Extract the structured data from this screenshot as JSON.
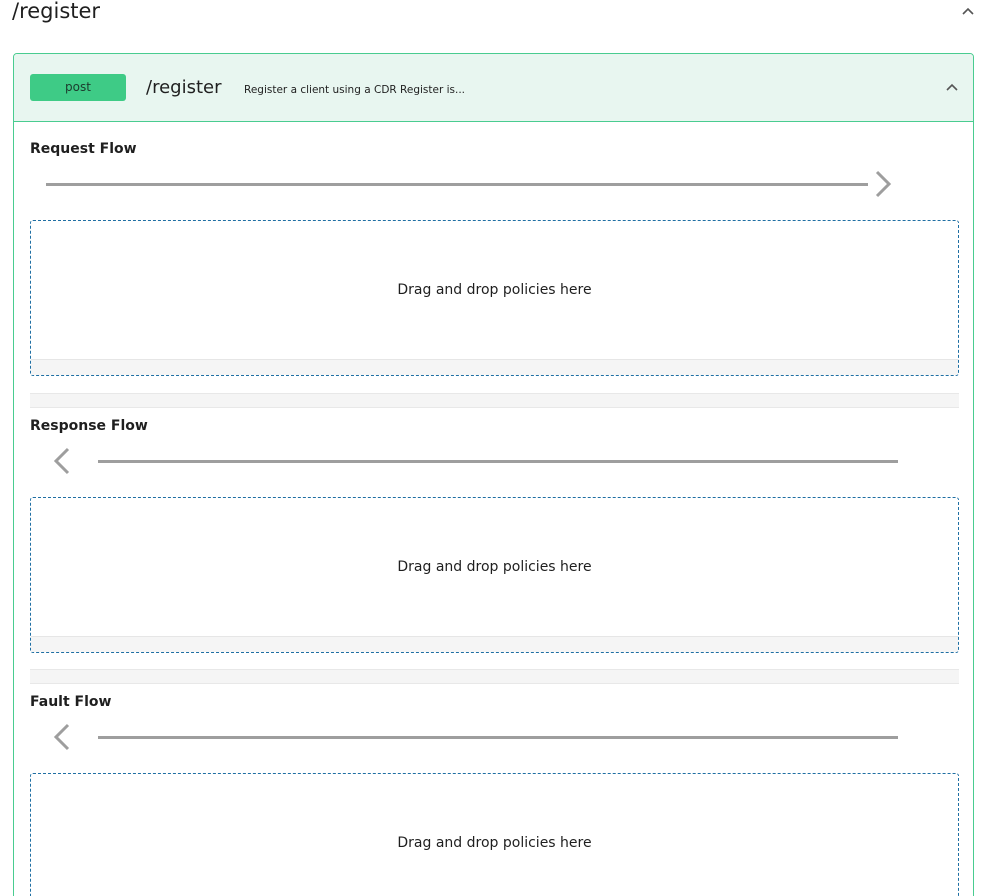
{
  "section": {
    "title": "/register"
  },
  "resource": {
    "method": "post",
    "path": "/register",
    "description": "Register a client using a CDR Register is...",
    "accent_color": "#49cc90",
    "header_bg": "#e8f6f0"
  },
  "flows": {
    "request": {
      "title": "Request Flow",
      "direction_icon": "chevron-right-icon",
      "dropzone_text": "Drag and drop policies here"
    },
    "response": {
      "title": "Response Flow",
      "direction_icon": "chevron-left-icon",
      "dropzone_text": "Drag and drop policies here"
    },
    "fault": {
      "title": "Fault Flow",
      "direction_icon": "chevron-left-icon",
      "dropzone_text": "Drag and drop policies here"
    }
  }
}
